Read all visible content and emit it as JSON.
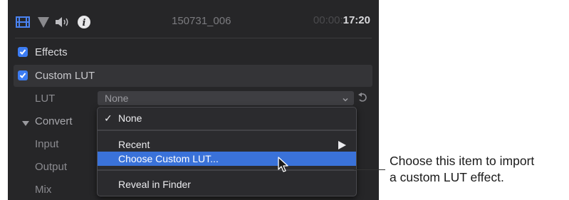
{
  "header": {
    "icons": [
      "video-inspector-icon",
      "color-inspector-icon",
      "audio-inspector-icon",
      "info-inspector-icon"
    ],
    "clip_name": "150731_006",
    "timecode_dim": "00:00:",
    "timecode_bright": "17:20"
  },
  "effects": {
    "label": "Effects",
    "checked": true
  },
  "custom_lut": {
    "label": "Custom LUT",
    "checked": true,
    "lut_label": "LUT",
    "lut_value": "None",
    "convert_label": "Convert",
    "input_label": "Input",
    "output_label": "Output",
    "mix_label": "Mix"
  },
  "menu": {
    "checkmark": "✓",
    "none_label": "None",
    "recent_label": "Recent",
    "choose_label": "Choose Custom LUT...",
    "reveal_label": "Reveal in Finder"
  },
  "callout": {
    "line1": "Choose this item to import",
    "line2": "a custom LUT effect."
  },
  "colors": {
    "panel_bg": "#262628",
    "accent_blue": "#3a72d9",
    "checkbox_blue": "#3c7cf3"
  }
}
